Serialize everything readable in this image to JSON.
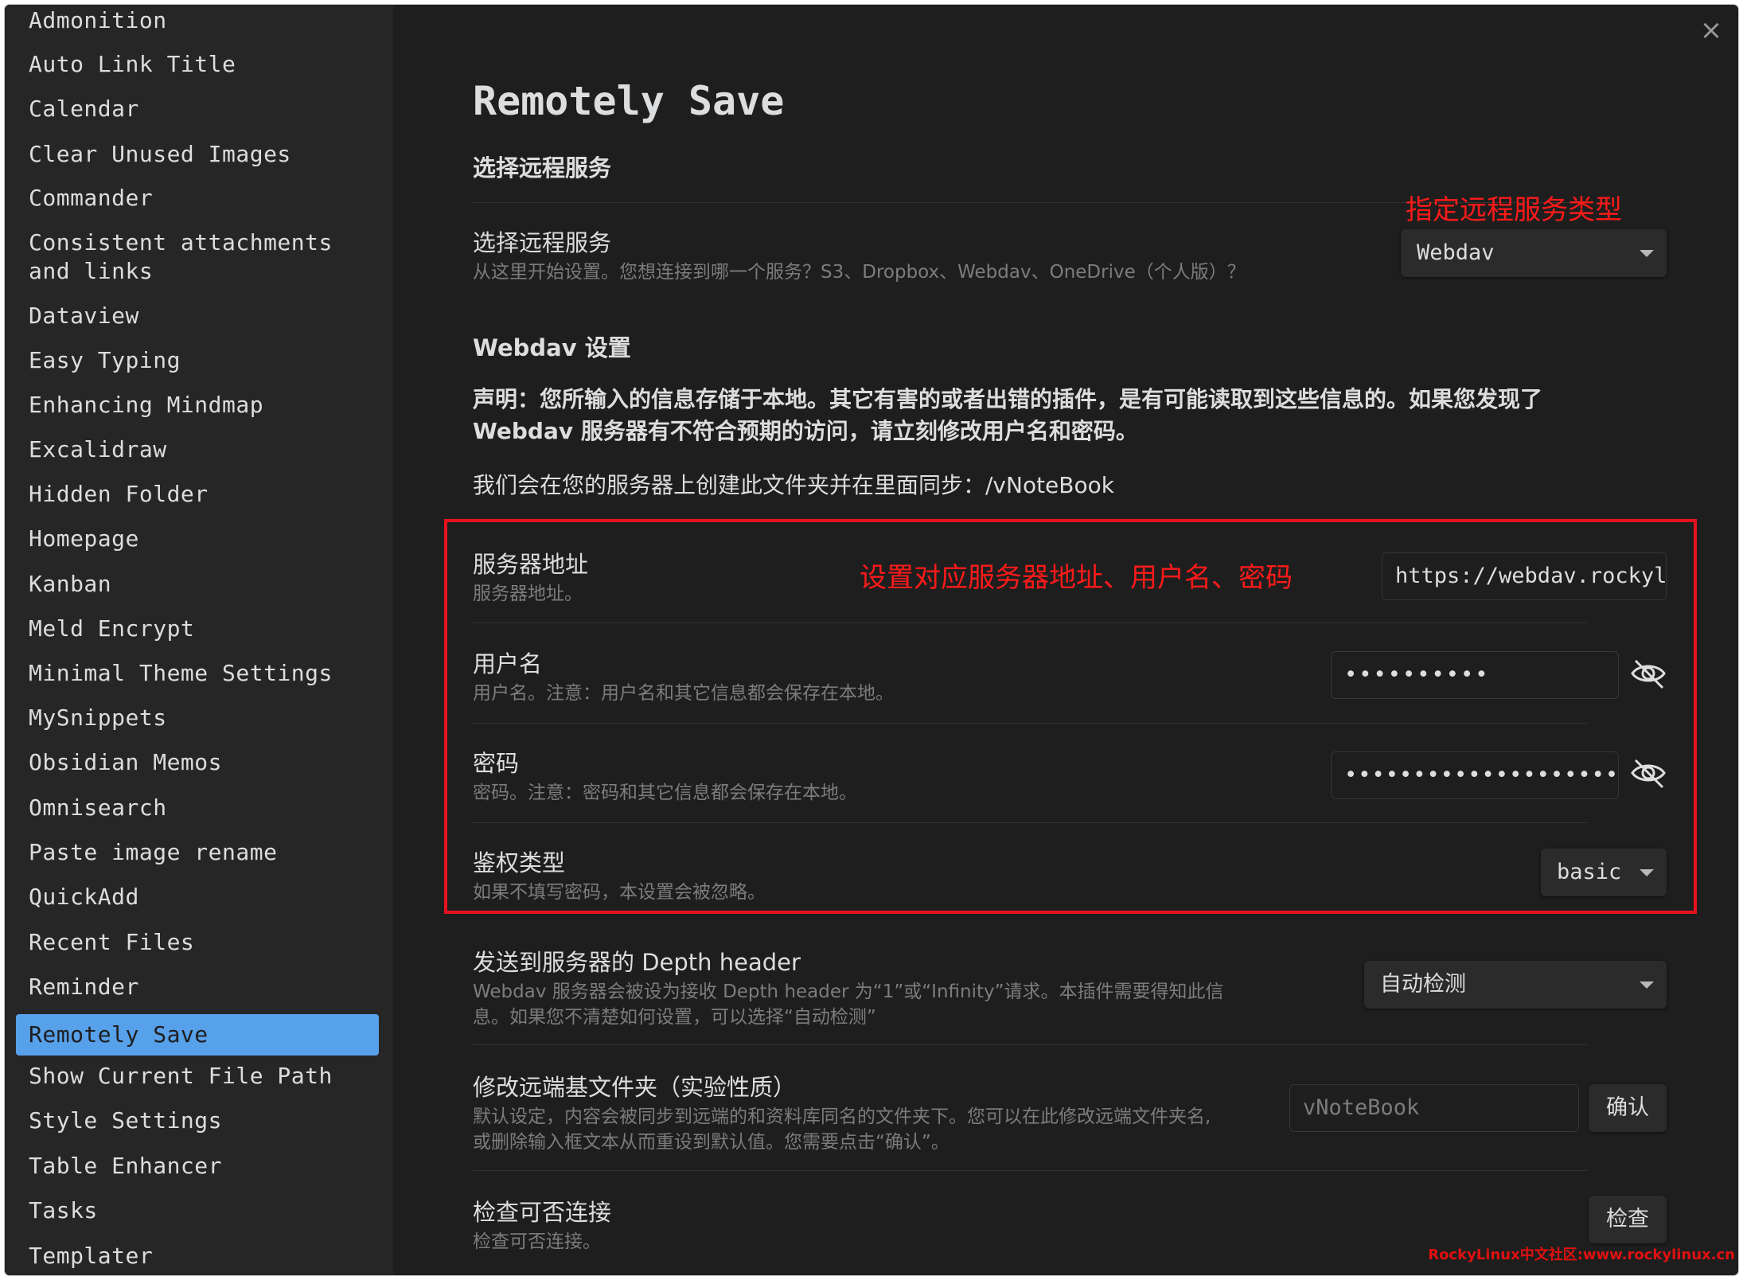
{
  "sidebar": {
    "items": [
      {
        "label": "Admonition"
      },
      {
        "label": "Auto Link Title"
      },
      {
        "label": "Calendar"
      },
      {
        "label": "Clear Unused Images"
      },
      {
        "label": "Commander"
      },
      {
        "label": "Consistent attachments"
      },
      {
        "label": "and links"
      },
      {
        "label": "Dataview"
      },
      {
        "label": "Easy Typing"
      },
      {
        "label": "Enhancing Mindmap"
      },
      {
        "label": "Excalidraw"
      },
      {
        "label": "Hidden Folder"
      },
      {
        "label": "Homepage"
      },
      {
        "label": "Kanban"
      },
      {
        "label": "Meld Encrypt"
      },
      {
        "label": "Minimal Theme Settings"
      },
      {
        "label": "MySnippets"
      },
      {
        "label": "Obsidian Memos"
      },
      {
        "label": "Omnisearch"
      },
      {
        "label": "Paste image rename"
      },
      {
        "label": "QuickAdd"
      },
      {
        "label": "Recent Files"
      },
      {
        "label": "Reminder"
      },
      {
        "label": "Remotely Save"
      },
      {
        "label": "Show Current File Path"
      },
      {
        "label": "Style Settings"
      },
      {
        "label": "Table Enhancer"
      },
      {
        "label": "Tasks"
      },
      {
        "label": "Templater"
      }
    ],
    "active": "Remotely Save"
  },
  "close_icon": "×",
  "page": {
    "title": "Remotely Save",
    "section_remote": "选择远程服务",
    "remote_service": {
      "name": "选择远程服务",
      "desc": "从这里开始设置。您想连接到哪一个服务？S3、Dropbox、Webdav、OneDrive（个人版）？",
      "value": "Webdav"
    },
    "section_webdav": "Webdav 设置",
    "disclaimer_line1": "声明：您所输入的信息存储于本地。其它有害的或者出错的插件，是有可能读取到这些信息的。如果您发现了",
    "disclaimer_line2": "Webdav 服务器有不符合预期的访问，请立刻修改用户名和密码。",
    "folder_note": "我们会在您的服务器上创建此文件夹并在里面同步：/vNoteBook",
    "server_address": {
      "name": "服务器地址",
      "desc": "服务器地址。",
      "value": "https://webdav.rockylinux.cn"
    },
    "username": {
      "name": "用户名",
      "desc": "用户名。注意：用户名和其它信息都会保存在本地。",
      "value": "••••••••••"
    },
    "password": {
      "name": "密码",
      "desc": "密码。注意：密码和其它信息都会保存在本地。",
      "value": "••••••••••••••••••••"
    },
    "auth_type": {
      "name": "鉴权类型",
      "desc": "如果不填写密码，本设置会被忽略。",
      "value": "basic"
    },
    "depth_header": {
      "name": "发送到服务器的 Depth header",
      "desc_line1": "Webdav 服务器会被设为接收 Depth header 为“1”或“Infinity”请求。本插件需要得知此信",
      "desc_line2": "息。如果您不清楚如何设置，可以选择“自动检测”",
      "value": "自动检测"
    },
    "base_folder": {
      "name": "修改远端基文件夹（实验性质）",
      "desc_line1": "默认设定，内容会被同步到远端的和资料库同名的文件夹下。您可以在此修改远端文件夹名,",
      "desc_line2": "或删除输入框文本从而重设到默认值。您需要点击“确认”。",
      "placeholder": "vNoteBook",
      "button": "确认"
    },
    "check_connection": {
      "name": "检查可否连接",
      "desc": "检查可否连接。",
      "button": "检查"
    }
  },
  "annotations": {
    "service_type": "指定远程服务类型",
    "server_fields": "设置对应服务器地址、用户名、密码",
    "watermark": "RockyLinux中文社区:www.rockylinux.cn"
  },
  "colors": {
    "accent": "#57a0ea",
    "annotation_red": "#e8121f",
    "background": "#1e1e1e",
    "sidebar": "#262626"
  }
}
